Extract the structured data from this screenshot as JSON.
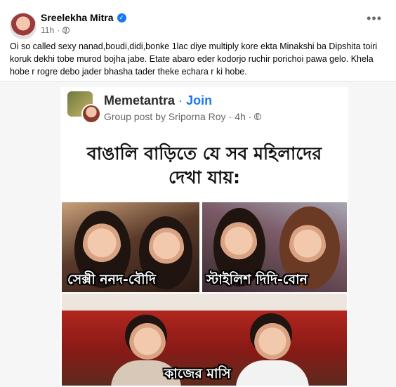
{
  "post": {
    "author": "Sreelekha Mitra",
    "time": "11h",
    "caption": "Oi so called sexy nanad,boudi,didi,bonke 1lac diye multiply kore ekta Minakshi ba Dipshita toiri koruk dekhi tobe murod bojha jabe. Etate abaro eder kodorjo ruchir porichoi pawa gelo. Khela hobe r rogre debo jader bhasha tader theke echara r ki hobe.",
    "more_label": "•••"
  },
  "shared": {
    "group_name": "Memetantra",
    "separator": "·",
    "join_label": "Join",
    "post_meta": "Group post by Sriporna Roy",
    "time": "4h",
    "headline_line1": "বাঙালি বাড়িতে যে সব মহিলাদের",
    "headline_line2": "দেখা যায়:",
    "labels": {
      "photo1": "সেক্সী ননদ-বৌদি",
      "photo2": "স্টাইলিশ দিদি-বোন",
      "photo3": "কাজের মাসি"
    }
  },
  "colors": {
    "accent": "#1877f2",
    "meta": "#65676b"
  }
}
